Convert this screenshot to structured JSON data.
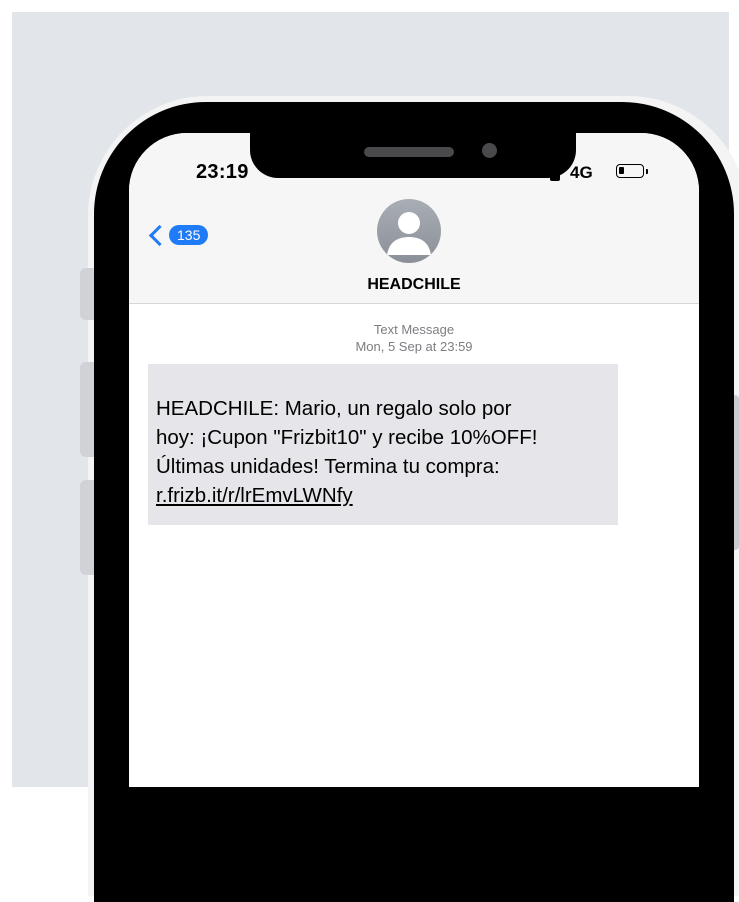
{
  "status_bar": {
    "time": "23:19",
    "network": "4G",
    "battery_level": 0.25
  },
  "nav": {
    "back_count": "135",
    "contact_name": "HEADCHILE",
    "avatar_icon": "person-silhouette-icon"
  },
  "conversation": {
    "message_type": "Text Message",
    "date": "Mon, 5 Sep at 23:59",
    "message": {
      "line1": "HEADCHILE: Mario, un regalo solo por",
      "line2": "hoy: ¡Cupon \"Frizbit10\" y recibe 10%OFF!",
      "line3": "Últimas unidades! Termina tu compra:",
      "link": "r.frizb.it/r/lrEmvLWNfy"
    }
  },
  "colors": {
    "accent": "#1f7bf6",
    "bubble": "#e5e5ea",
    "header_bg": "#f6f6f6",
    "meta_text": "#7d7d82"
  }
}
